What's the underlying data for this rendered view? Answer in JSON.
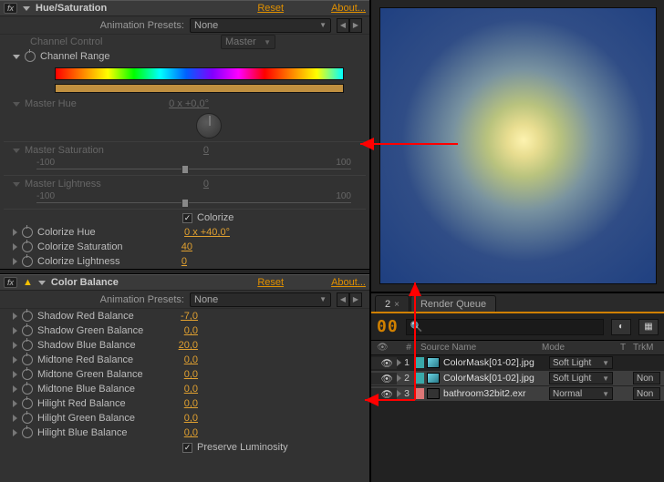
{
  "hue_sat": {
    "title": "Hue/Saturation",
    "reset": "Reset",
    "about": "About...",
    "preset_label": "Animation Presets:",
    "preset_value": "None",
    "channel_control": "Channel Control",
    "channel_value": "Master",
    "channel_range": "Channel Range",
    "master_hue": "Master Hue",
    "master_hue_val": "0 x +0,0°",
    "master_sat": "Master Saturation",
    "master_sat_val": "0",
    "master_light": "Master Lightness",
    "master_light_val": "0",
    "range_lo": "-100",
    "range_hi": "100",
    "colorize": "Colorize",
    "col_hue": "Colorize Hue",
    "col_hue_val": "0 x +40,0°",
    "col_sat": "Colorize Saturation",
    "col_sat_val": "40",
    "col_light": "Colorize Lightness",
    "col_light_val": "0"
  },
  "color_balance": {
    "title": "Color Balance",
    "reset": "Reset",
    "about": "About...",
    "preset_label": "Animation Presets:",
    "preset_value": "None",
    "params": [
      {
        "name": "Shadow Red Balance",
        "val": "-7,0"
      },
      {
        "name": "Shadow Green Balance",
        "val": "0,0"
      },
      {
        "name": "Shadow Blue Balance",
        "val": "20,0"
      },
      {
        "name": "Midtone Red Balance",
        "val": "0,0"
      },
      {
        "name": "Midtone Green Balance",
        "val": "0,0"
      },
      {
        "name": "Midtone Blue Balance",
        "val": "0,0"
      },
      {
        "name": "Hilight Red Balance",
        "val": "0,0"
      },
      {
        "name": "Hilight Green Balance",
        "val": "0,0"
      },
      {
        "name": "Hilight Blue Balance",
        "val": "0,0"
      }
    ],
    "preserve": "Preserve Luminosity"
  },
  "tabs": {
    "active": "2",
    "render_queue": "Render Queue"
  },
  "timecode": "00",
  "search_placeholder": "",
  "columns": {
    "idx": "#",
    "source": "Source Name",
    "mode": "Mode",
    "t": "T",
    "trk": "TrkM"
  },
  "layers": [
    {
      "idx": "1",
      "name": "ColorMask[01-02].jpg",
      "mode": "Soft Light",
      "trk": "",
      "swatch": "teal",
      "sel": false,
      "thumb": 1
    },
    {
      "idx": "2",
      "name": "ColorMask[01-02].jpg",
      "mode": "Soft Light",
      "trk": "Non",
      "swatch": "teal",
      "sel": true,
      "thumb": 1
    },
    {
      "idx": "3",
      "name": "bathroom32bit2.exr",
      "mode": "Normal",
      "trk": "Non",
      "swatch": "pink",
      "sel": true,
      "thumb": 2
    }
  ],
  "check_mark": "✓"
}
